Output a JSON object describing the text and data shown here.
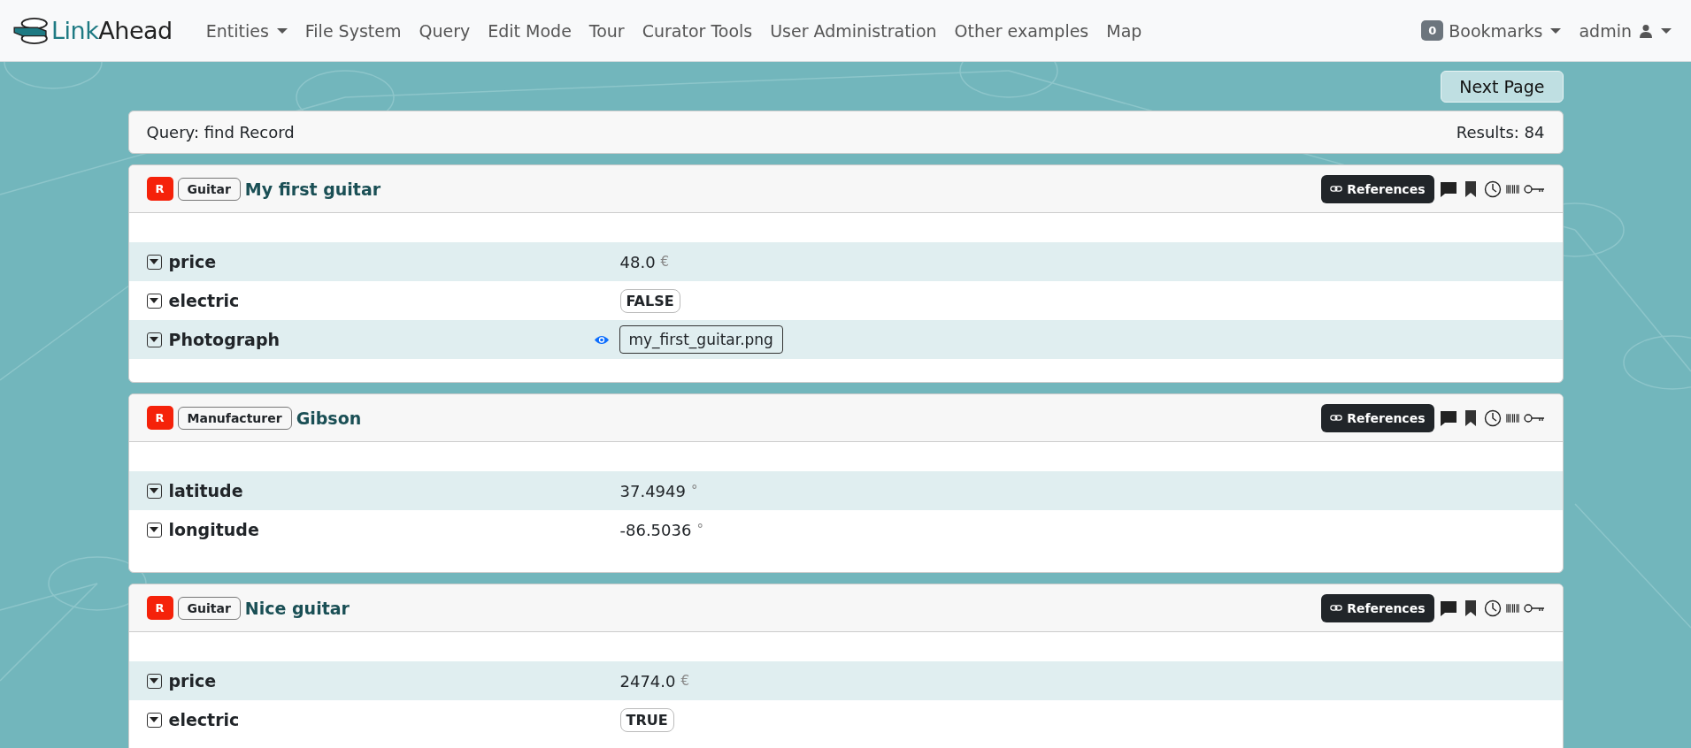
{
  "navbar": {
    "brand": {
      "link": "Link",
      "ahead": "Ahead"
    },
    "items": [
      {
        "label": "Entities",
        "dropdown": true
      },
      {
        "label": "File System",
        "dropdown": false
      },
      {
        "label": "Query",
        "dropdown": false
      },
      {
        "label": "Edit Mode",
        "dropdown": false
      },
      {
        "label": "Tour",
        "dropdown": false
      },
      {
        "label": "Curator Tools",
        "dropdown": false
      },
      {
        "label": "User Administration",
        "dropdown": false
      },
      {
        "label": "Other examples",
        "dropdown": false
      },
      {
        "label": "Map",
        "dropdown": false
      }
    ],
    "bookmarks": {
      "count": "0",
      "label": "Bookmarks"
    },
    "user": {
      "label": "admin"
    }
  },
  "next_page": "Next Page",
  "query_bar": {
    "query": "Query: find Record",
    "results": "Results: 84"
  },
  "records": [
    {
      "role": "R",
      "type": "Guitar",
      "name": "My first guitar",
      "references": "References",
      "properties": [
        {
          "name": "price",
          "kind": "number",
          "value": "48.0",
          "unit": "€"
        },
        {
          "name": "electric",
          "kind": "boolean",
          "value": "FALSE"
        },
        {
          "name": "Photograph",
          "kind": "file",
          "value": "my_first_guitar.png"
        }
      ]
    },
    {
      "role": "R",
      "type": "Manufacturer",
      "name": "Gibson",
      "references": "References",
      "properties": [
        {
          "name": "latitude",
          "kind": "number",
          "value": "37.4949",
          "unit": "°"
        },
        {
          "name": "longitude",
          "kind": "number",
          "value": "-86.5036",
          "unit": "°"
        }
      ]
    },
    {
      "role": "R",
      "type": "Guitar",
      "name": "Nice guitar",
      "references": "References",
      "properties": [
        {
          "name": "price",
          "kind": "number",
          "value": "2474.0",
          "unit": "€"
        },
        {
          "name": "electric",
          "kind": "boolean",
          "value": "TRUE"
        }
      ]
    }
  ]
}
